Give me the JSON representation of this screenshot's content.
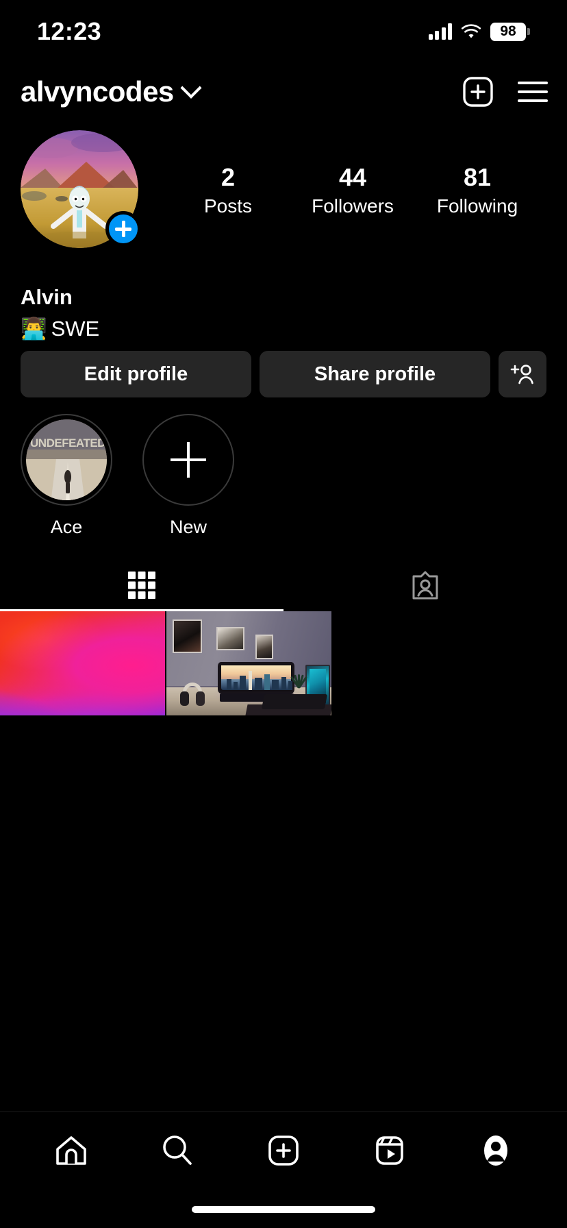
{
  "status_bar": {
    "time": "12:23",
    "battery_level": "98",
    "signal_icon": "cellular-bars-icon",
    "wifi_icon": "wifi-icon",
    "battery_icon": "battery-icon"
  },
  "header": {
    "username": "alvyncodes",
    "dropdown_icon": "chevron-down-icon",
    "add_icon": "new-post-icon",
    "menu_icon": "hamburger-menu-icon"
  },
  "profile": {
    "avatar_name": "profile-picture",
    "add_story_icon": "plus-icon",
    "full_name": "Alvin",
    "bio_emoji": "👨‍💻",
    "bio_text": "SWE",
    "stats": [
      {
        "value": "2",
        "label": "Posts"
      },
      {
        "value": "44",
        "label": "Followers"
      },
      {
        "value": "81",
        "label": "Following"
      }
    ]
  },
  "actions": {
    "edit_profile": "Edit profile",
    "share_profile": "Share profile",
    "discover_people_icon": "add-person-icon"
  },
  "highlights": [
    {
      "label": "Ace",
      "type": "story",
      "cover_text": "UNDEFEATED"
    },
    {
      "label": "New",
      "type": "new",
      "icon": "plus-icon"
    }
  ],
  "tabs": [
    {
      "name": "grid",
      "icon": "grid-icon",
      "active": true
    },
    {
      "name": "tagged",
      "icon": "tagged-person-icon",
      "active": false
    }
  ],
  "posts": [
    {
      "name": "post-gradient-wallpaper",
      "description": "abstract red pink purple gradient wallpaper"
    },
    {
      "name": "post-desk-setup",
      "description": "gaming desk setup with ultrawide monitor and RGB PC"
    }
  ],
  "bottom_nav": [
    {
      "name": "home",
      "icon": "home-icon",
      "active": false
    },
    {
      "name": "search",
      "icon": "search-icon",
      "active": false
    },
    {
      "name": "create",
      "icon": "create-post-icon",
      "active": false
    },
    {
      "name": "reels",
      "icon": "reels-icon",
      "active": false
    },
    {
      "name": "profile",
      "icon": "profile-avatar-icon",
      "active": true
    }
  ],
  "colors": {
    "background": "#000000",
    "button_bg": "#262626",
    "accent_blue": "#0095f6",
    "text": "#ffffff"
  }
}
